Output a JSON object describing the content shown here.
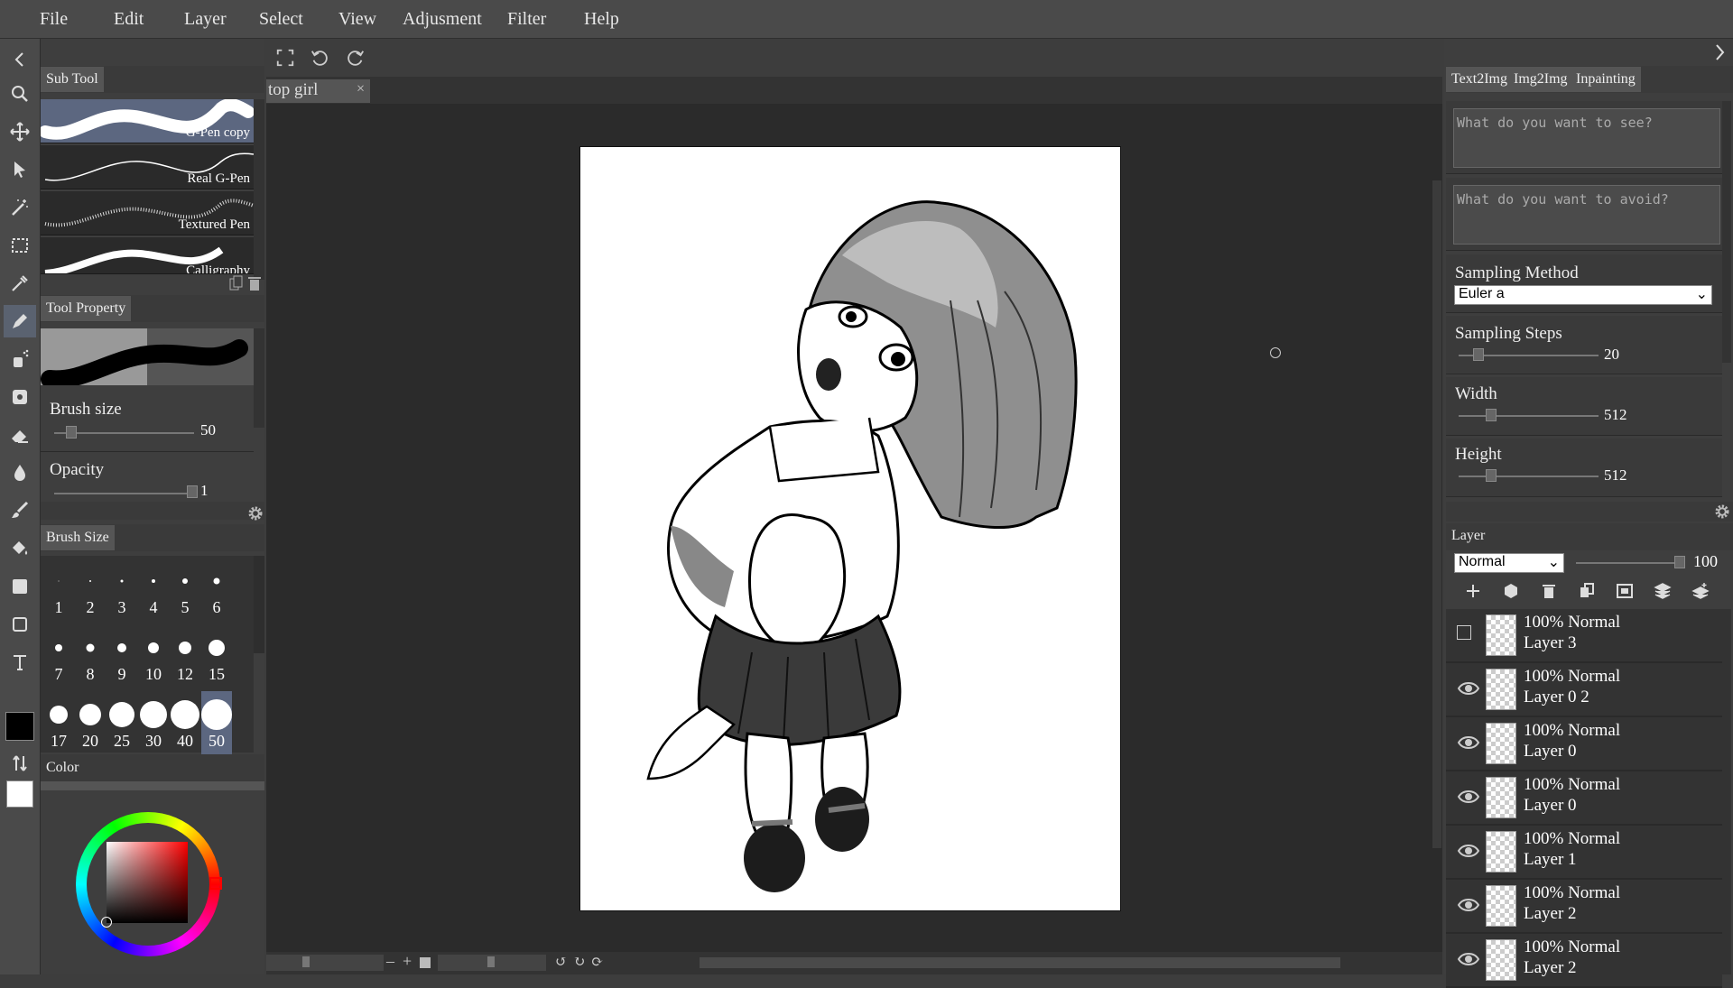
{
  "menu": [
    "File",
    "Edit",
    "Layer",
    "Select",
    "View",
    "Adjusment",
    "Filter",
    "Help"
  ],
  "left_panel": {
    "sub_tool_title": "Sub Tool",
    "brushes": [
      {
        "name": "G-Pen copy",
        "selected": true
      },
      {
        "name": "Real G-Pen",
        "selected": false
      },
      {
        "name": "Textured Pen",
        "selected": false
      },
      {
        "name": "Calligraphy",
        "selected": false
      }
    ],
    "tool_property_title": "Tool Property",
    "brush_size_label": "Brush size",
    "brush_size_value": "50",
    "opacity_label": "Opacity",
    "opacity_value": "1",
    "brush_size_title": "Brush Size",
    "sizes": [
      "1",
      "2",
      "3",
      "4",
      "5",
      "6",
      "7",
      "8",
      "9",
      "10",
      "12",
      "15",
      "17",
      "20",
      "25",
      "30",
      "40",
      "50"
    ],
    "selected_size": "50",
    "color_title": "Color",
    "main_color": "#000000",
    "sub_color": "#ffffff"
  },
  "document": {
    "tab_title": "top girl",
    "close_glyph": "×"
  },
  "right_panel": {
    "tabs": [
      "Text2Img",
      "Img2Img",
      "Inpainting"
    ],
    "prompt_placeholder": "What do you want to see?",
    "negative_placeholder": "What do you want to avoid?",
    "sampling_method_label": "Sampling Method",
    "sampling_method_value": "Euler a",
    "sampling_steps_label": "Sampling Steps",
    "sampling_steps_value": "20",
    "width_label": "Width",
    "width_value": "512",
    "height_label": "Height",
    "height_value": "512",
    "layer_title": "Layer",
    "blend_mode": "Normal",
    "layer_opacity": "100",
    "layers": [
      {
        "mode": "100% Normal",
        "name": "Layer 3",
        "visible": false
      },
      {
        "mode": "100% Normal",
        "name": "Layer 0 2",
        "visible": true
      },
      {
        "mode": "100% Normal",
        "name": "Layer 0",
        "visible": true
      },
      {
        "mode": "100% Normal",
        "name": "Layer 0",
        "visible": true
      },
      {
        "mode": "100% Normal",
        "name": "Layer 1",
        "visible": true
      },
      {
        "mode": "100% Normal",
        "name": "Layer 2",
        "visible": true
      },
      {
        "mode": "100% Normal",
        "name": "Layer 2",
        "visible": true
      }
    ]
  },
  "colors": {
    "accent": "#5c6780",
    "panel": "#3e3e3e",
    "canvas_bg": "#2b2b2b"
  }
}
